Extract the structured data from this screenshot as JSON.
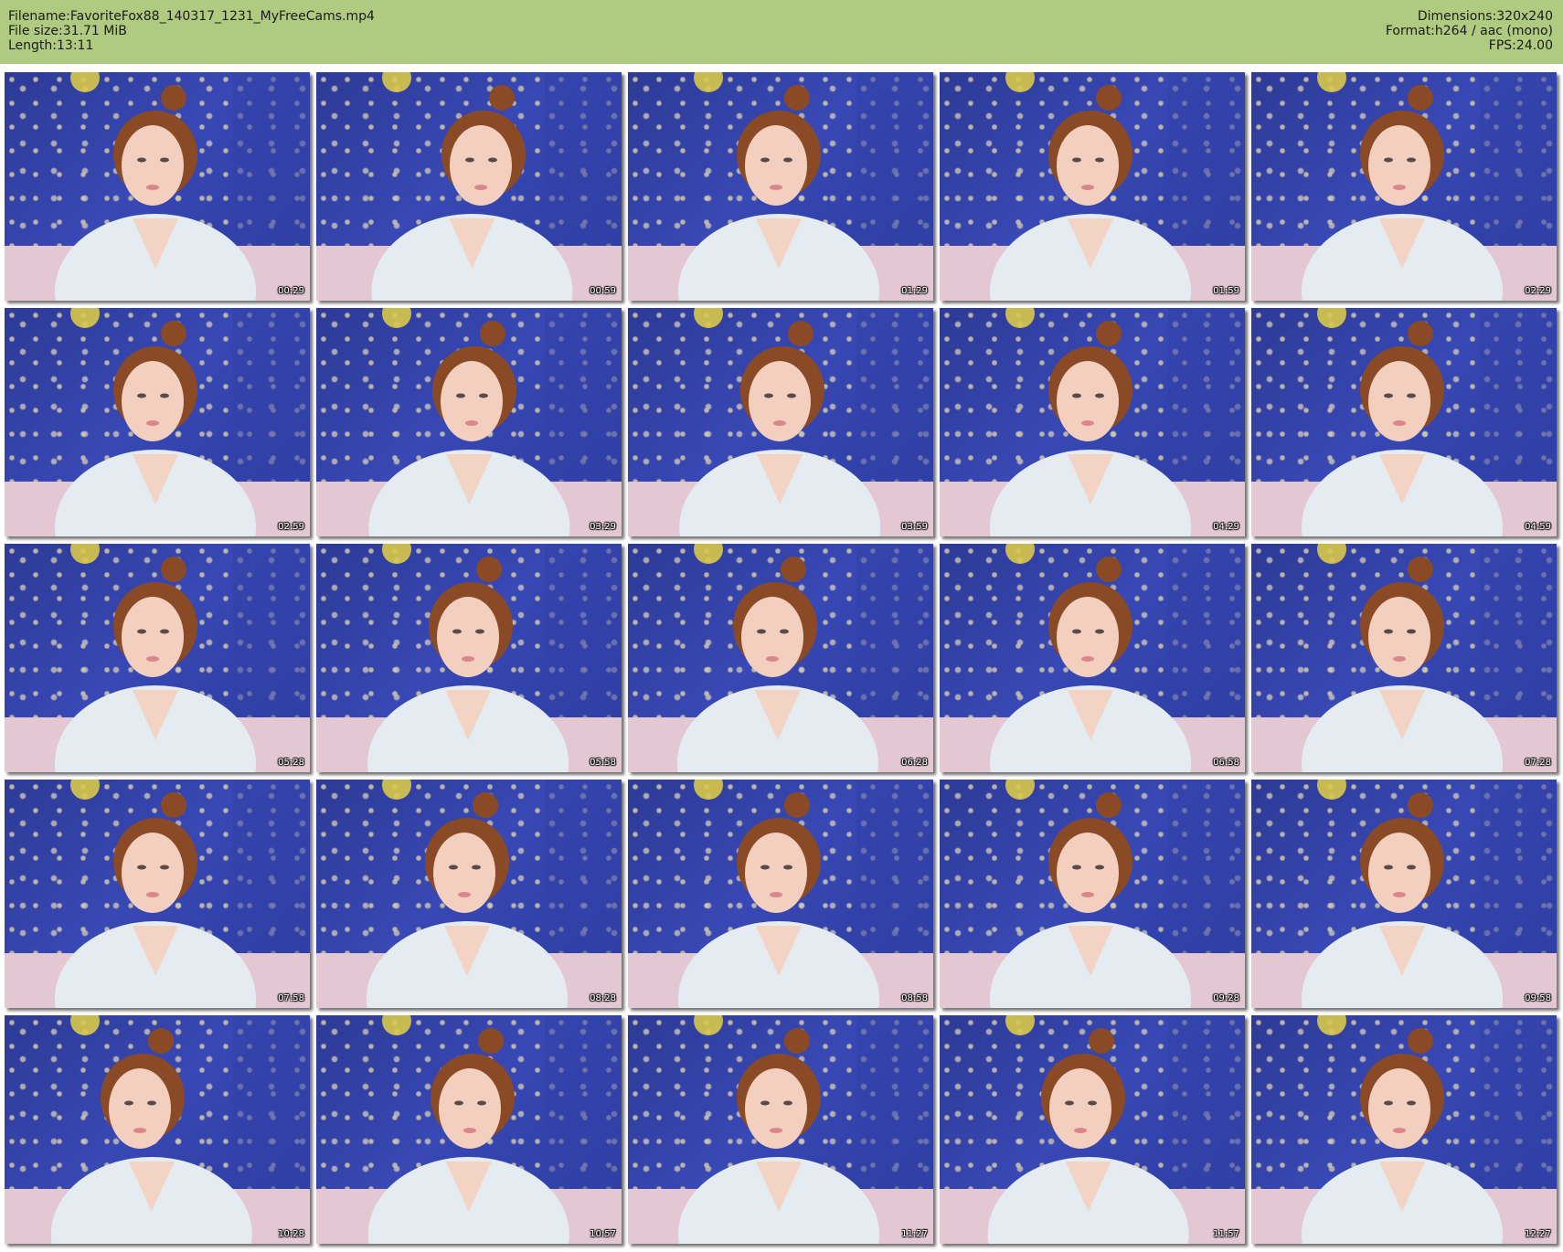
{
  "header": {
    "filename_label": "Filename:",
    "filename": "FavoriteFox88_140317_1231_MyFreeCams.mp4",
    "filesize_label": "File size:",
    "filesize": "31.71 MiB",
    "length_label": "Length:",
    "length": "13:11",
    "dimensions_label": "Dimensions:",
    "dimensions": "320x240",
    "format_label": "Format:",
    "format": "h264 / aac (mono)",
    "fps_label": "FPS:",
    "fps": "24.00"
  },
  "thumbnails": [
    "00:29",
    "00:59",
    "01:29",
    "01:59",
    "02:29",
    "02:59",
    "03:29",
    "03:59",
    "04:29",
    "04:59",
    "05:28",
    "05:58",
    "06:28",
    "06:58",
    "07:28",
    "07:58",
    "08:28",
    "08:58",
    "09:28",
    "09:58",
    "10:28",
    "10:57",
    "11:27",
    "11:57",
    "12:27"
  ],
  "colors": {
    "header_bg": "#afcb80",
    "wallpaper_blue": "#3242a8",
    "robe_white": "#e4ecf2",
    "hair_auburn": "#8a4a26",
    "couch_pink": "#e3c7d3"
  }
}
